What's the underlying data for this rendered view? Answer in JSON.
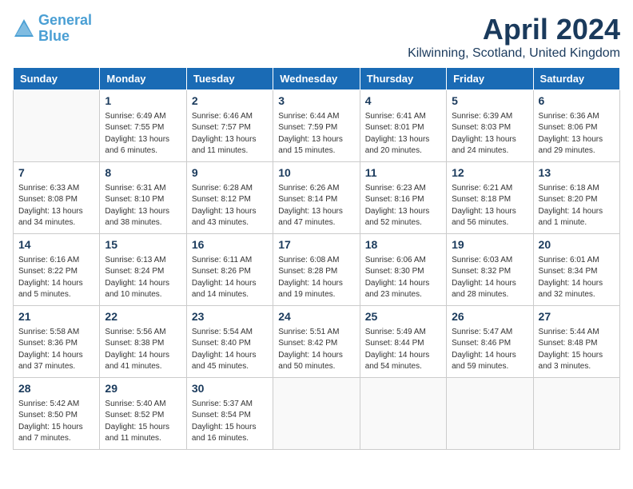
{
  "logo": {
    "line1": "General",
    "line2": "Blue"
  },
  "title": "April 2024",
  "subtitle": "Kilwinning, Scotland, United Kingdom",
  "days_of_week": [
    "Sunday",
    "Monday",
    "Tuesday",
    "Wednesday",
    "Thursday",
    "Friday",
    "Saturday"
  ],
  "weeks": [
    [
      {
        "day": "",
        "info": ""
      },
      {
        "day": "1",
        "info": "Sunrise: 6:49 AM\nSunset: 7:55 PM\nDaylight: 13 hours\nand 6 minutes."
      },
      {
        "day": "2",
        "info": "Sunrise: 6:46 AM\nSunset: 7:57 PM\nDaylight: 13 hours\nand 11 minutes."
      },
      {
        "day": "3",
        "info": "Sunrise: 6:44 AM\nSunset: 7:59 PM\nDaylight: 13 hours\nand 15 minutes."
      },
      {
        "day": "4",
        "info": "Sunrise: 6:41 AM\nSunset: 8:01 PM\nDaylight: 13 hours\nand 20 minutes."
      },
      {
        "day": "5",
        "info": "Sunrise: 6:39 AM\nSunset: 8:03 PM\nDaylight: 13 hours\nand 24 minutes."
      },
      {
        "day": "6",
        "info": "Sunrise: 6:36 AM\nSunset: 8:06 PM\nDaylight: 13 hours\nand 29 minutes."
      }
    ],
    [
      {
        "day": "7",
        "info": "Sunrise: 6:33 AM\nSunset: 8:08 PM\nDaylight: 13 hours\nand 34 minutes."
      },
      {
        "day": "8",
        "info": "Sunrise: 6:31 AM\nSunset: 8:10 PM\nDaylight: 13 hours\nand 38 minutes."
      },
      {
        "day": "9",
        "info": "Sunrise: 6:28 AM\nSunset: 8:12 PM\nDaylight: 13 hours\nand 43 minutes."
      },
      {
        "day": "10",
        "info": "Sunrise: 6:26 AM\nSunset: 8:14 PM\nDaylight: 13 hours\nand 47 minutes."
      },
      {
        "day": "11",
        "info": "Sunrise: 6:23 AM\nSunset: 8:16 PM\nDaylight: 13 hours\nand 52 minutes."
      },
      {
        "day": "12",
        "info": "Sunrise: 6:21 AM\nSunset: 8:18 PM\nDaylight: 13 hours\nand 56 minutes."
      },
      {
        "day": "13",
        "info": "Sunrise: 6:18 AM\nSunset: 8:20 PM\nDaylight: 14 hours\nand 1 minute."
      }
    ],
    [
      {
        "day": "14",
        "info": "Sunrise: 6:16 AM\nSunset: 8:22 PM\nDaylight: 14 hours\nand 5 minutes."
      },
      {
        "day": "15",
        "info": "Sunrise: 6:13 AM\nSunset: 8:24 PM\nDaylight: 14 hours\nand 10 minutes."
      },
      {
        "day": "16",
        "info": "Sunrise: 6:11 AM\nSunset: 8:26 PM\nDaylight: 14 hours\nand 14 minutes."
      },
      {
        "day": "17",
        "info": "Sunrise: 6:08 AM\nSunset: 8:28 PM\nDaylight: 14 hours\nand 19 minutes."
      },
      {
        "day": "18",
        "info": "Sunrise: 6:06 AM\nSunset: 8:30 PM\nDaylight: 14 hours\nand 23 minutes."
      },
      {
        "day": "19",
        "info": "Sunrise: 6:03 AM\nSunset: 8:32 PM\nDaylight: 14 hours\nand 28 minutes."
      },
      {
        "day": "20",
        "info": "Sunrise: 6:01 AM\nSunset: 8:34 PM\nDaylight: 14 hours\nand 32 minutes."
      }
    ],
    [
      {
        "day": "21",
        "info": "Sunrise: 5:58 AM\nSunset: 8:36 PM\nDaylight: 14 hours\nand 37 minutes."
      },
      {
        "day": "22",
        "info": "Sunrise: 5:56 AM\nSunset: 8:38 PM\nDaylight: 14 hours\nand 41 minutes."
      },
      {
        "day": "23",
        "info": "Sunrise: 5:54 AM\nSunset: 8:40 PM\nDaylight: 14 hours\nand 45 minutes."
      },
      {
        "day": "24",
        "info": "Sunrise: 5:51 AM\nSunset: 8:42 PM\nDaylight: 14 hours\nand 50 minutes."
      },
      {
        "day": "25",
        "info": "Sunrise: 5:49 AM\nSunset: 8:44 PM\nDaylight: 14 hours\nand 54 minutes."
      },
      {
        "day": "26",
        "info": "Sunrise: 5:47 AM\nSunset: 8:46 PM\nDaylight: 14 hours\nand 59 minutes."
      },
      {
        "day": "27",
        "info": "Sunrise: 5:44 AM\nSunset: 8:48 PM\nDaylight: 15 hours\nand 3 minutes."
      }
    ],
    [
      {
        "day": "28",
        "info": "Sunrise: 5:42 AM\nSunset: 8:50 PM\nDaylight: 15 hours\nand 7 minutes."
      },
      {
        "day": "29",
        "info": "Sunrise: 5:40 AM\nSunset: 8:52 PM\nDaylight: 15 hours\nand 11 minutes."
      },
      {
        "day": "30",
        "info": "Sunrise: 5:37 AM\nSunset: 8:54 PM\nDaylight: 15 hours\nand 16 minutes."
      },
      {
        "day": "",
        "info": ""
      },
      {
        "day": "",
        "info": ""
      },
      {
        "day": "",
        "info": ""
      },
      {
        "day": "",
        "info": ""
      }
    ]
  ]
}
